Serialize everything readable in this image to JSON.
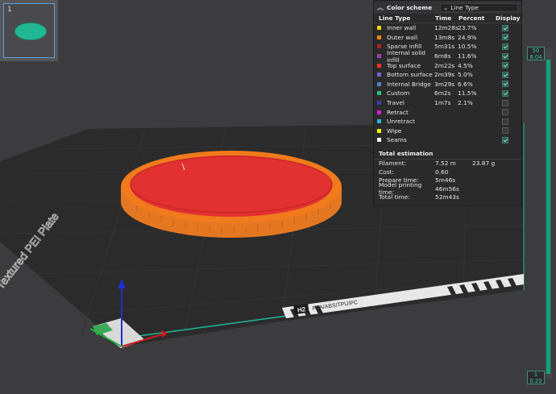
{
  "thumbnail": {
    "index": "1"
  },
  "legend": {
    "header_title": "Color scheme",
    "scheme_value": "Line Type",
    "columns": {
      "type": "Line Type",
      "time": "Time",
      "percent": "Percent",
      "display": "Display"
    },
    "rows": [
      {
        "name": "Inner wall",
        "time": "12m28s",
        "pct": "23.7%",
        "color": "#f5d400",
        "display": true
      },
      {
        "name": "Outer wall",
        "time": "13m8s",
        "pct": "24.9%",
        "color": "#ff7f00",
        "display": true
      },
      {
        "name": "Sparse infill",
        "time": "5m31s",
        "pct": "10.5%",
        "color": "#b2221d",
        "display": true
      },
      {
        "name": "Internal solid infill",
        "time": "6m8s",
        "pct": "11.6%",
        "color": "#9a3fae",
        "display": true
      },
      {
        "name": "Top surface",
        "time": "2m22s",
        "pct": "4.5%",
        "color": "#ff2d2d",
        "display": true
      },
      {
        "name": "Bottom surface",
        "time": "2m39s",
        "pct": "5.0%",
        "color": "#7b5fd2",
        "display": true
      },
      {
        "name": "Internal Bridge",
        "time": "3m29s",
        "pct": "6.6%",
        "color": "#4f83c4",
        "display": true
      },
      {
        "name": "Custom",
        "time": "6m2s",
        "pct": "11.5%",
        "color": "#22c77a",
        "display": true
      },
      {
        "name": "Travel",
        "time": "1m7s",
        "pct": "2.1%",
        "color": "#3d3db8",
        "display": false
      },
      {
        "name": "Retract",
        "time": "",
        "pct": "",
        "color": "#d41fd4",
        "display": false
      },
      {
        "name": "Unretract",
        "time": "",
        "pct": "",
        "color": "#1fb8d4",
        "display": false
      },
      {
        "name": "Wipe",
        "time": "",
        "pct": "",
        "color": "#f5f500",
        "display": false
      },
      {
        "name": "Seams",
        "time": "",
        "pct": "",
        "color": "#f2f2f2",
        "display": true
      }
    ],
    "total_title": "Total estimation",
    "summary": [
      {
        "label": "Filament:",
        "value": "7.52 m",
        "extra": "23.87 g"
      },
      {
        "label": "Cost:",
        "value": "0.60",
        "extra": ""
      },
      {
        "label": "Prepare time:",
        "value": "5m46s",
        "extra": ""
      },
      {
        "label": "Model printing time:",
        "value": "46m56s",
        "extra": ""
      },
      {
        "label": "Total time:",
        "value": "52m43s",
        "extra": ""
      }
    ]
  },
  "slider": {
    "top_layer": "50",
    "top_height": "8.04",
    "bottom_layer": "1",
    "bottom_height": "0.20"
  },
  "plate": {
    "name": "Textured PEI Plate",
    "material": "PLA/ABS/TPU/PC",
    "logo": "H2"
  },
  "colors": {
    "accent": "#0fa581",
    "plate": "#2a2a2b",
    "model": "#e03030",
    "wall": "#f07a1c"
  }
}
